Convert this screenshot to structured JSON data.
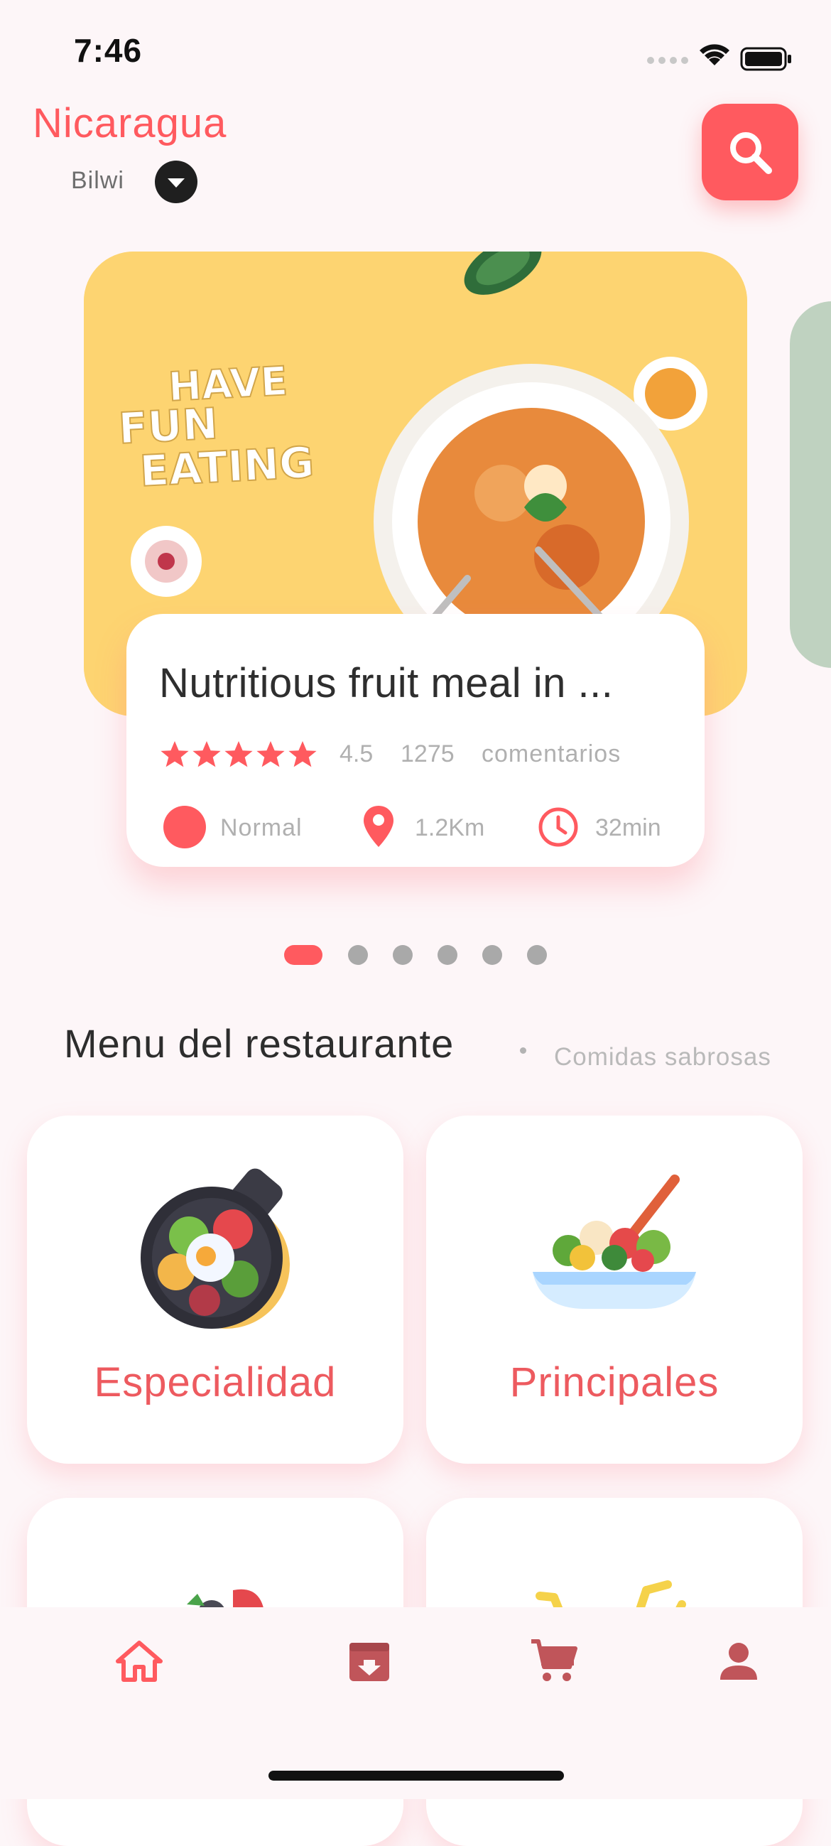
{
  "status_bar": {
    "time": "7:46"
  },
  "header": {
    "city": "Nicaragua",
    "district": "Bilwi",
    "icons": {
      "dropdown": "chevron-down-icon",
      "search": "search-icon"
    }
  },
  "featured": {
    "banner_text": "HAVE FUN EATING",
    "title": "Nutritious fruit meal in ...",
    "stars": 5,
    "rating": "4.5",
    "review_count": "1275",
    "review_word": "comentarios",
    "type_label": "Normal",
    "distance": "1.2Km",
    "duration": "32min",
    "icons": {
      "distance": "location-pin-icon",
      "duration": "clock-icon"
    }
  },
  "pager": {
    "count": 6,
    "active": 0
  },
  "menu_section": {
    "title": "Menu del restaurante",
    "subtitle": "Comidas sabrosas",
    "categories": [
      {
        "label": "Especialidad",
        "icon": "bibimbap-icon"
      },
      {
        "label": "Principales",
        "icon": "salad-icon"
      },
      {
        "label": "",
        "icon": "dessert-icon"
      },
      {
        "label": "",
        "icon": "drinks-icon"
      }
    ]
  },
  "bottom_nav": {
    "items": [
      {
        "name": "home",
        "icon": "home-icon",
        "active": true
      },
      {
        "name": "orders",
        "icon": "archive-icon",
        "active": false
      },
      {
        "name": "cart",
        "icon": "cart-icon",
        "active": false
      },
      {
        "name": "profile",
        "icon": "person-icon",
        "active": false
      }
    ]
  },
  "colors": {
    "accent": "#ff5a5f",
    "background": "#fdf6f8",
    "banner": "#fdd471",
    "muted_text": "#b0b0b0",
    "nav_inactive": "#c0555a"
  }
}
